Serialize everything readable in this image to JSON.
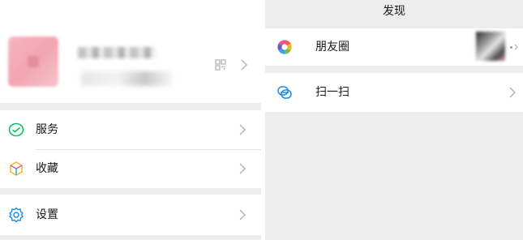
{
  "profile": {
    "avatar_color": "#f2a5b0"
  },
  "menu": {
    "items": [
      {
        "label": "服务",
        "icon": "service-icon",
        "color": "#07c160"
      },
      {
        "label": "收藏",
        "icon": "favorites-icon",
        "color": "#f8b32a"
      },
      {
        "label": "设置",
        "icon": "settings-icon",
        "color": "#1a8ce8"
      }
    ]
  },
  "discover": {
    "title": "发现",
    "items": [
      {
        "label": "朋友圈",
        "icon": "moments-icon"
      },
      {
        "label": "扫一扫",
        "icon": "scan-icon",
        "color": "#1a8ce8"
      }
    ]
  }
}
